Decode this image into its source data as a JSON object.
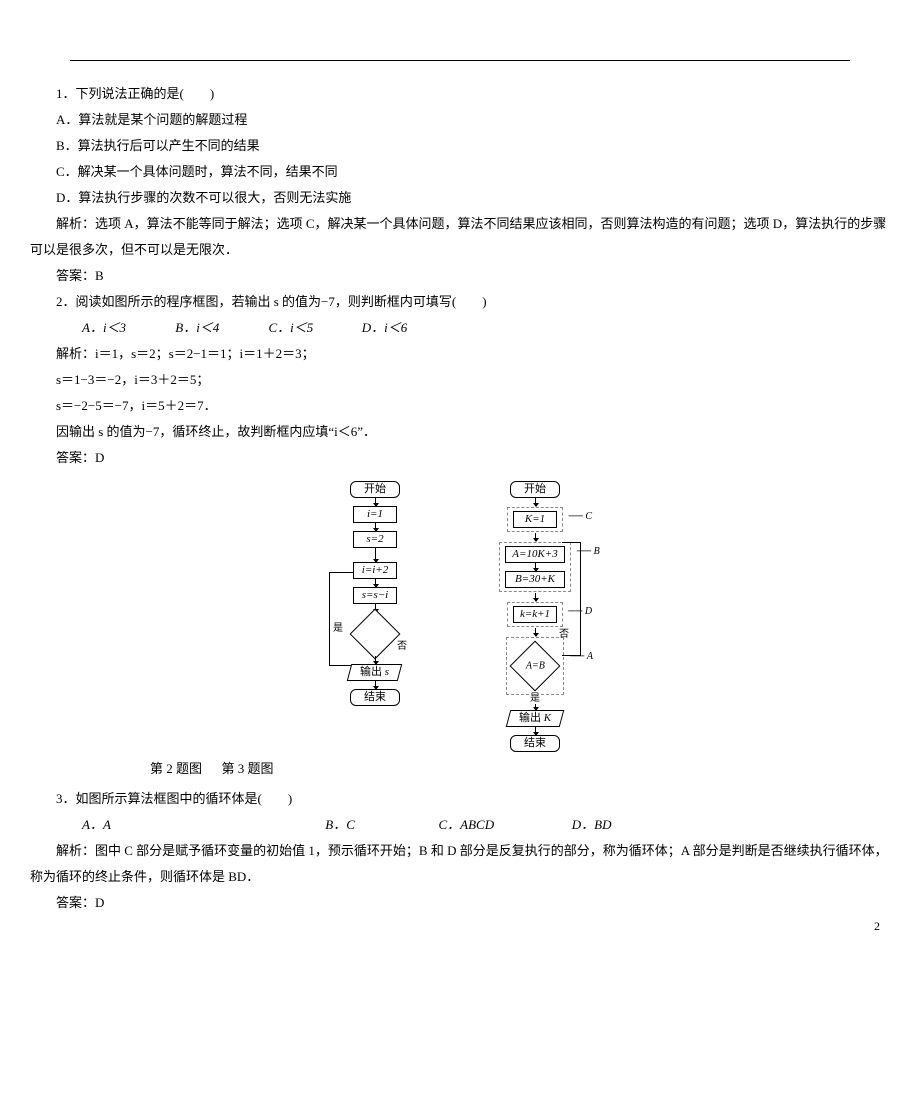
{
  "q1": {
    "stem": "1．下列说法正确的是(　　)",
    "optA": "A．算法就是某个问题的解题过程",
    "optB": "B．算法执行后可以产生不同的结果",
    "optC": "C．解决某一个具体问题时，算法不同，结果不同",
    "optD": "D．算法执行步骤的次数不可以很大，否则无法实施",
    "analysis": "解析：选项 A，算法不能等同于解法；选项 C，解决某一个具体问题，算法不同结果应该相同，否则算法构造的有问题；选项 D，算法执行的步骤可以是很多次，但不可以是无限次．",
    "answer": "答案：B"
  },
  "q2": {
    "stem": "2．阅读如图所示的程序框图，若输出 s 的值为−7，则判断框内可填写(　　)",
    "optA": "A．i＜3",
    "optB": "B．i＜4",
    "optC": "C．i＜5",
    "optD": "D．i＜6",
    "ana1": "解析：i＝1，s＝2；s＝2−1＝1；i＝1＋2＝3；",
    "ana2": "s＝1−3＝−2，i＝3＋2＝5；",
    "ana3": "s＝−2−5＝−7，i＝5＋2＝7．",
    "ana4": "因输出 s 的值为−7，循环终止，故判断框内应填“i＜6”．",
    "answer": "答案：D"
  },
  "fig_labels": {
    "f2_cap": "第 2 题图",
    "f3_cap": "第 3 题图"
  },
  "q3": {
    "stem": "3．如图所示算法框图中的循环体是(　　)",
    "optA": "A．A",
    "optB": "B．C",
    "optC": "C．ABCD",
    "optD": "D．BD",
    "analysis": "解析：图中 C 部分是赋予循环变量的初始值 1，预示循环开始；B 和 D 部分是反复执行的部分，称为循环体；A 部分是判断是否继续执行循环体，称为循环的终止条件，则循环体是 BD．",
    "answer": "答案：D"
  },
  "page_number": "2",
  "chart_data": [
    {
      "type": "flowchart",
      "title": "第2题图",
      "nodes": [
        {
          "id": "start",
          "shape": "terminator",
          "text": "开始"
        },
        {
          "id": "n1",
          "shape": "process",
          "text": "i=1"
        },
        {
          "id": "n2",
          "shape": "process",
          "text": "s=2"
        },
        {
          "id": "n3",
          "shape": "process",
          "text": "i=i+2"
        },
        {
          "id": "n4",
          "shape": "process",
          "text": "s=s−i"
        },
        {
          "id": "d1",
          "shape": "decision",
          "text": "",
          "yes_label": "是",
          "no_label": "否"
        },
        {
          "id": "out",
          "shape": "io",
          "text": "输出 s"
        },
        {
          "id": "end",
          "shape": "terminator",
          "text": "结束"
        }
      ],
      "edges": [
        [
          "start",
          "n1"
        ],
        [
          "n1",
          "n2"
        ],
        [
          "n2",
          "n3"
        ],
        [
          "n3",
          "n4"
        ],
        [
          "n4",
          "d1"
        ],
        [
          "d1",
          "n3",
          "是(loop back)"
        ],
        [
          "d1",
          "out",
          "否"
        ],
        [
          "out",
          "end"
        ]
      ]
    },
    {
      "type": "flowchart",
      "title": "第3题图",
      "nodes": [
        {
          "id": "start",
          "shape": "terminator",
          "text": "开始"
        },
        {
          "id": "c",
          "shape": "process",
          "text": "K=1",
          "group": "C"
        },
        {
          "id": "b1",
          "shape": "process",
          "text": "A=10K+3",
          "group": "B"
        },
        {
          "id": "b2",
          "shape": "process",
          "text": "B=30+K",
          "group": "B"
        },
        {
          "id": "d",
          "shape": "process",
          "text": "k=k+1",
          "group": "D"
        },
        {
          "id": "a",
          "shape": "decision",
          "text": "A=B",
          "group": "A",
          "yes_label": "是",
          "no_label": "否"
        },
        {
          "id": "out",
          "shape": "io",
          "text": "输出 K"
        },
        {
          "id": "end",
          "shape": "terminator",
          "text": "结束"
        }
      ],
      "edges": [
        [
          "start",
          "c"
        ],
        [
          "c",
          "b1"
        ],
        [
          "b1",
          "b2"
        ],
        [
          "b2",
          "d"
        ],
        [
          "d",
          "a"
        ],
        [
          "a",
          "b1",
          "否(loop back)"
        ],
        [
          "a",
          "out",
          "是"
        ],
        [
          "out",
          "end"
        ]
      ],
      "group_labels": {
        "C": "C",
        "B": "B",
        "D": "D",
        "A": "A"
      }
    }
  ]
}
